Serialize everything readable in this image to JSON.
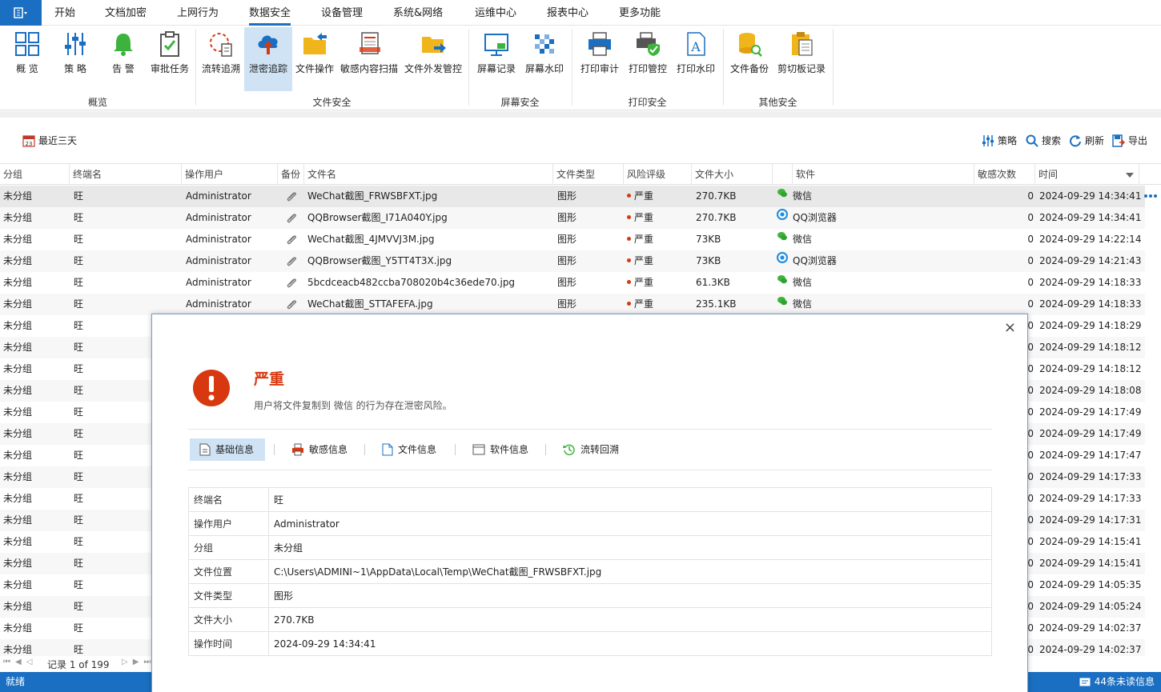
{
  "menu": {
    "app_icon": "menu-icon",
    "tabs": [
      "开始",
      "文档加密",
      "上网行为",
      "数据安全",
      "设备管理",
      "系统&网络",
      "运维中心",
      "报表中心",
      "更多功能"
    ],
    "active_tab": "数据安全"
  },
  "ribbon": {
    "buttons": {
      "overview": "概 览",
      "policy": "策 略",
      "alert": "告 警",
      "approval": "审批任务",
      "flow_trace": "流转追溯",
      "leak_trace": "泄密追踪",
      "file_ops": "文件操作",
      "sensitive_scan": "敏感内容扫描",
      "outgoing": "文件外发管控",
      "screen_record": "屏幕记录",
      "screen_watermark": "屏幕水印",
      "print_audit": "打印审计",
      "print_control": "打印管控",
      "print_watermark": "打印水印",
      "file_backup": "文件备份",
      "clipboard": "剪切板记录"
    },
    "groups": {
      "overview": "概览",
      "file_security": "文件安全",
      "screen_security": "屏幕安全",
      "print_security": "打印安全",
      "other_security": "其他安全"
    }
  },
  "toolbar": {
    "date_range": "最近三天",
    "policy": "策略",
    "search": "搜索",
    "refresh": "刷新",
    "export": "导出"
  },
  "grid": {
    "columns": [
      "分组",
      "终端名",
      "操作用户",
      "备份",
      "文件名",
      "文件类型",
      "风险评级",
      "文件大小",
      "",
      "软件",
      "敏感次数",
      "时间"
    ],
    "rows": [
      {
        "group": "未分组",
        "terminal": "旺",
        "user": "Administrator",
        "file": "WeChat截图_FRWSBFXT.jpg",
        "type": "图形",
        "risk": "严重",
        "size": "270.7KB",
        "software": "微信",
        "count": "0",
        "time": "2024-09-29 14:34:41"
      },
      {
        "group": "未分组",
        "terminal": "旺",
        "user": "Administrator",
        "file": "QQBrowser截图_I71A040Y.jpg",
        "type": "图形",
        "risk": "严重",
        "size": "270.7KB",
        "software": "QQ浏览器",
        "count": "0",
        "time": "2024-09-29 14:34:41"
      },
      {
        "group": "未分组",
        "terminal": "旺",
        "user": "Administrator",
        "file": "WeChat截图_4JMVVJ3M.jpg",
        "type": "图形",
        "risk": "严重",
        "size": "73KB",
        "software": "微信",
        "count": "0",
        "time": "2024-09-29 14:22:14"
      },
      {
        "group": "未分组",
        "terminal": "旺",
        "user": "Administrator",
        "file": "QQBrowser截图_Y5TT4T3X.jpg",
        "type": "图形",
        "risk": "严重",
        "size": "73KB",
        "software": "QQ浏览器",
        "count": "0",
        "time": "2024-09-29 14:21:43"
      },
      {
        "group": "未分组",
        "terminal": "旺",
        "user": "Administrator",
        "file": "5bcdceacb482ccba708020b4c36ede70.jpg",
        "type": "图形",
        "risk": "严重",
        "size": "61.3KB",
        "software": "微信",
        "count": "0",
        "time": "2024-09-29 14:18:33"
      },
      {
        "group": "未分组",
        "terminal": "旺",
        "user": "Administrator",
        "file": "WeChat截图_STTAFEFA.jpg",
        "type": "图形",
        "risk": "严重",
        "size": "235.1KB",
        "software": "微信",
        "count": "0",
        "time": "2024-09-29 14:18:33"
      },
      {
        "group": "未分组",
        "terminal": "旺",
        "count": "0",
        "time": "2024-09-29 14:18:29"
      },
      {
        "group": "未分组",
        "terminal": "旺",
        "count": "0",
        "time": "2024-09-29 14:18:12"
      },
      {
        "group": "未分组",
        "terminal": "旺",
        "count": "0",
        "time": "2024-09-29 14:18:12"
      },
      {
        "group": "未分组",
        "terminal": "旺",
        "count": "0",
        "time": "2024-09-29 14:18:08"
      },
      {
        "group": "未分组",
        "terminal": "旺",
        "count": "0",
        "time": "2024-09-29 14:17:49"
      },
      {
        "group": "未分组",
        "terminal": "旺",
        "count": "0",
        "time": "2024-09-29 14:17:49"
      },
      {
        "group": "未分组",
        "terminal": "旺",
        "count": "0",
        "time": "2024-09-29 14:17:47"
      },
      {
        "group": "未分组",
        "terminal": "旺",
        "count": "0",
        "time": "2024-09-29 14:17:33"
      },
      {
        "group": "未分组",
        "terminal": "旺",
        "count": "0",
        "time": "2024-09-29 14:17:33"
      },
      {
        "group": "未分组",
        "terminal": "旺",
        "count": "0",
        "time": "2024-09-29 14:17:31"
      },
      {
        "group": "未分组",
        "terminal": "旺",
        "count": "0",
        "time": "2024-09-29 14:15:41"
      },
      {
        "group": "未分组",
        "terminal": "旺",
        "count": "0",
        "time": "2024-09-29 14:15:41"
      },
      {
        "group": "未分组",
        "terminal": "旺",
        "count": "0",
        "time": "2024-09-29 14:05:35"
      },
      {
        "group": "未分组",
        "terminal": "旺",
        "count": "0",
        "time": "2024-09-29 14:05:24"
      },
      {
        "group": "未分组",
        "terminal": "旺",
        "count": "0",
        "time": "2024-09-29 14:02:37"
      },
      {
        "group": "未分组",
        "terminal": "旺",
        "count": "0",
        "time": "2024-09-29 14:02:37"
      }
    ]
  },
  "pager": {
    "text": "记录 1 of 199"
  },
  "status": {
    "left": "就绪",
    "right": "44条未读信息"
  },
  "dialog": {
    "close": "×",
    "title": "严重",
    "description": "用户将文件复制到 微信 的行为存在泄密风险。",
    "tabs": [
      "基础信息",
      "敏感信息",
      "文件信息",
      "软件信息",
      "流转回溯"
    ],
    "info": [
      {
        "key": "终端名",
        "value": "旺"
      },
      {
        "key": "操作用户",
        "value": "Administrator"
      },
      {
        "key": "分组",
        "value": "未分组"
      },
      {
        "key": "文件位置",
        "value": "C:\\Users\\ADMINI~1\\AppData\\Local\\Temp\\WeChat截图_FRWSBFXT.jpg"
      },
      {
        "key": "文件类型",
        "value": "图形"
      },
      {
        "key": "文件大小",
        "value": "270.7KB"
      },
      {
        "key": "操作时间",
        "value": "2024-09-29 14:34:41"
      }
    ]
  },
  "colors": {
    "accent": "#1a6fc2",
    "danger": "#d8380f",
    "selected_bg": "#cfe3f5"
  }
}
